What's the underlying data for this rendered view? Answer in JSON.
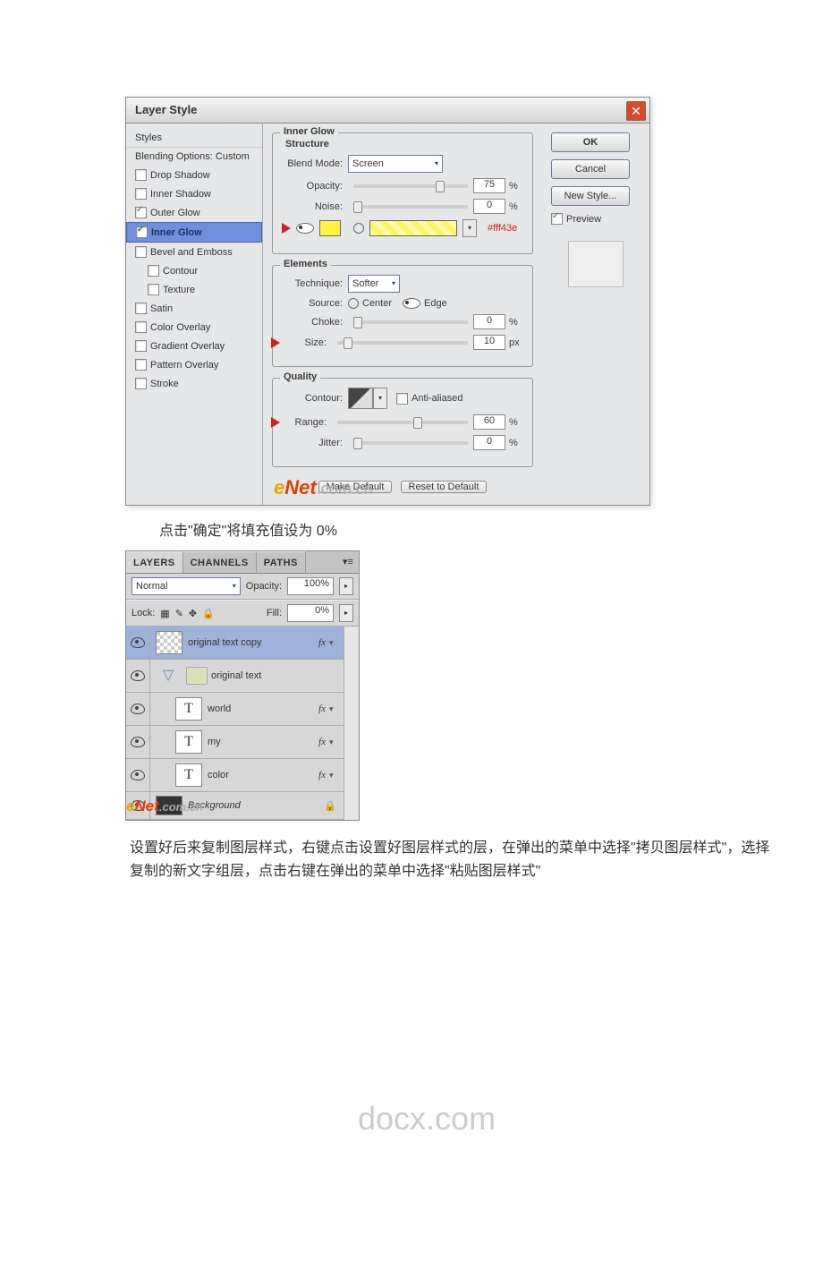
{
  "layerStyle": {
    "title": "Layer Style",
    "sidebar": {
      "styles": "Styles",
      "blendopt": "Blending Options: Custom",
      "dropShadow": "Drop Shadow",
      "innerShadow": "Inner Shadow",
      "outerGlow": "Outer Glow",
      "innerGlow": "Inner Glow",
      "bevel": "Bevel and Emboss",
      "contour": "Contour",
      "texture": "Texture",
      "satin": "Satin",
      "colorOverlay": "Color Overlay",
      "gradientOverlay": "Gradient Overlay",
      "patternOverlay": "Pattern Overlay",
      "stroke": "Stroke"
    },
    "buttons": {
      "ok": "OK",
      "cancel": "Cancel",
      "newstyle": "New Style...",
      "preview": "Preview"
    },
    "structure": {
      "title": "Inner Glow",
      "sub": "Structure",
      "blendModeLabel": "Blend Mode:",
      "blendMode": "Screen",
      "opacityLabel": "Opacity:",
      "opacity": "75",
      "opacityUnit": "%",
      "noiseLabel": "Noise:",
      "noise": "0",
      "noiseUnit": "%",
      "color": "#fff43e"
    },
    "elements": {
      "title": "Elements",
      "techLabel": "Technique:",
      "tech": "Softer",
      "sourceLabel": "Source:",
      "center": "Center",
      "edge": "Edge",
      "chokeLabel": "Choke:",
      "choke": "0",
      "chokeUnit": "%",
      "sizeLabel": "Size:",
      "size": "10",
      "sizeUnit": "px"
    },
    "quality": {
      "title": "Quality",
      "contourLabel": "Contour:",
      "aa": "Anti-aliased",
      "rangeLabel": "Range:",
      "range": "60",
      "rangeUnit": "%",
      "jitterLabel": "Jitter:",
      "jitter": "0",
      "jitterUnit": "%"
    },
    "defaults": {
      "make": "Make Default",
      "reset": "Reset to Default"
    }
  },
  "watermark": {
    "e": "e",
    "net": "Net",
    "ext": ".com.cn",
    "docx": "docx.com"
  },
  "para1": "点击\"确定\"将填充值设为 0%",
  "layersPanel": {
    "tabs": {
      "layers": "LAYERS",
      "channels": "CHANNELS",
      "paths": "PATHS"
    },
    "blend": "Normal",
    "opacityLabel": "Opacity:",
    "opacity": "100%",
    "lockLabel": "Lock:",
    "fillLabel": "Fill:",
    "fill": "0%",
    "items": {
      "origCopy": "original text copy",
      "origText": "original text",
      "world": "world",
      "my": "my",
      "color": "color",
      "background": "Background"
    },
    "fx": "fx"
  },
  "para2": "设置好后来复制图层样式，右键点击设置好图层样式的层，在弹出的菜单中选择\"拷贝图层样式\"，选择复制的新文字组层，点击右键在弹出的菜单中选择\"粘贴图层样式\""
}
